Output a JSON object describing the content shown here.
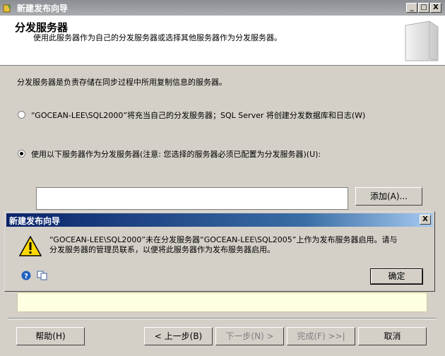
{
  "window": {
    "title": "新建发布向导",
    "minimize": "_",
    "maximize": "□",
    "close": "X"
  },
  "header": {
    "title": "分发服务器",
    "subtitle": "使用此服务器作为自己的分发服务器或选择其他服务器作为分发服务器。"
  },
  "main": {
    "description": "分发服务器是负责存储在同步过程中所用复制信息的服务器。",
    "option1_label": "“GOCEAN-LEE\\SQL2000”将充当自己的分发服务器；SQL Server 将创建分发数据库和日志(W)",
    "option2_label": "使用以下服务器作为分发服务器(注意: 您选择的服务器必须已配置为分发服务器)(U):",
    "add_button": "添加(A)...",
    "selected_option": "option2"
  },
  "dialog": {
    "title": "新建发布向导",
    "close": "X",
    "message_line1": "“GOCEAN-LEE\\SQL2000”未在分发服务器“GOCEAN-LEE\\SQL2005”上作为发布服务器启用。请与",
    "message_line2": "分发服务器的管理员联系，以便将此服务器作为发布服务器启用。",
    "ok_button": "确定"
  },
  "footer": {
    "help": "帮助(H)",
    "back": "< 上一步(B)",
    "next": "下一步(N) >",
    "finish": "完成(F) >>|",
    "cancel": "取消"
  },
  "colors": {
    "dialog_title": "#0a246a",
    "info_panel": "#ffffe1"
  }
}
